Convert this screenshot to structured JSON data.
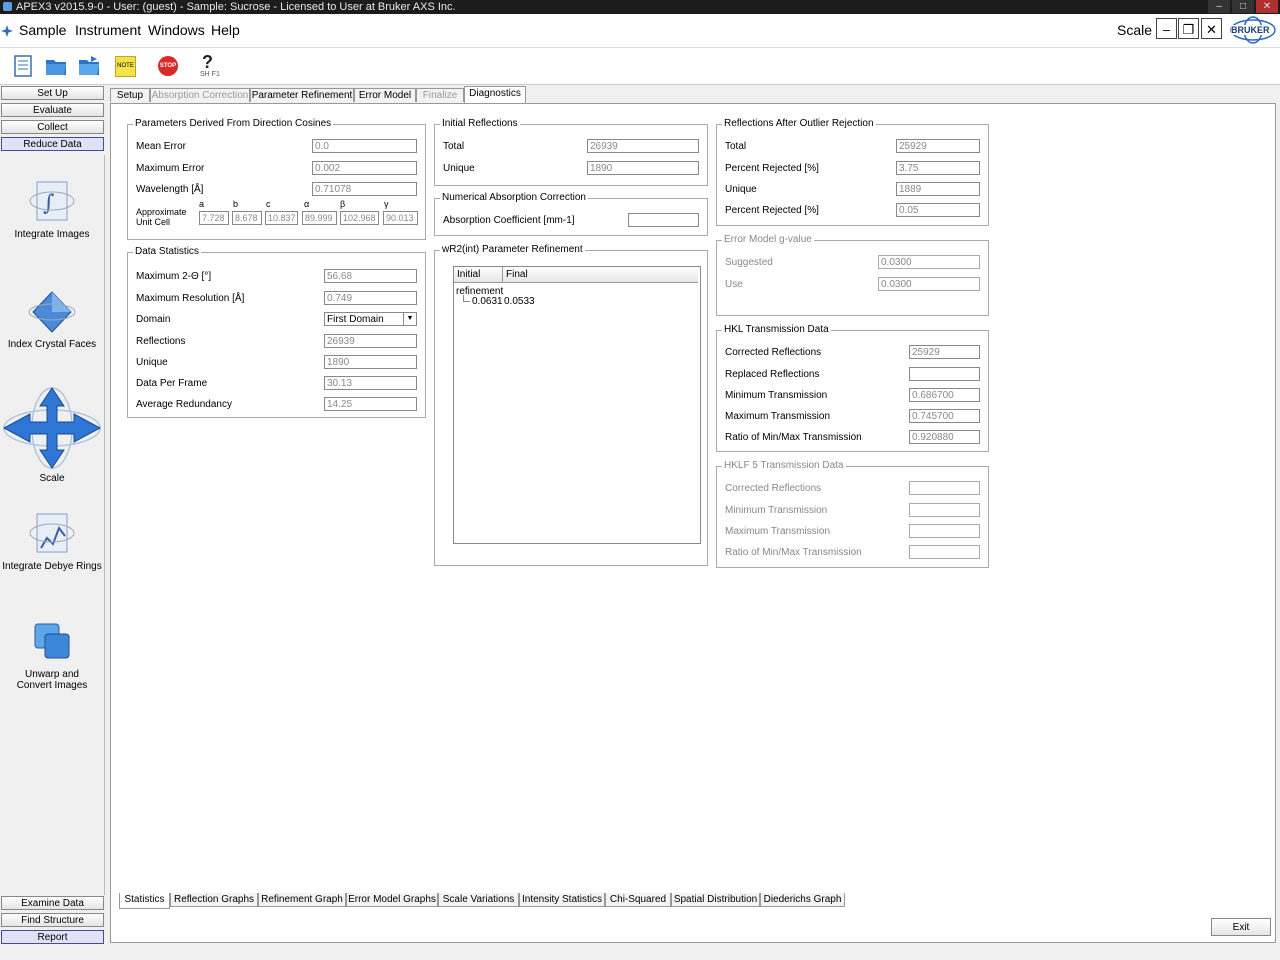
{
  "window": {
    "title": "APEX3 v2015.9-0 - User: (guest) - Sample: Sucrose - Licensed to User at Bruker AXS Inc."
  },
  "menu": {
    "items": [
      "Sample",
      "Instrument",
      "Windows",
      "Help"
    ],
    "current_view": "Scale",
    "brand": "BRUKER"
  },
  "toolbar": {
    "note_label": "NOTE",
    "stop_label": "STOP",
    "help_label": "SH F1"
  },
  "nav": {
    "top_buttons": [
      "Set Up",
      "Evaluate",
      "Collect",
      "Reduce Data"
    ],
    "tasks": [
      "Integrate Images",
      "Index Crystal Faces",
      "Scale",
      "Integrate Debye Rings",
      "Unwarp and Convert Images"
    ],
    "bottom_buttons": [
      "Examine Data",
      "Find Structure",
      "Report"
    ]
  },
  "top_tabs": [
    "Setup",
    "Absorption Correction",
    "Parameter Refinement",
    "Error Model",
    "Finalize",
    "Diagnostics"
  ],
  "direction_cosines": {
    "title": "Parameters Derived From Direction Cosines",
    "mean_error_label": "Mean Error",
    "mean_error": "0.0",
    "max_error_label": "Maximum Error",
    "max_error": "0.002",
    "wavelength_label": "Wavelength [Å]",
    "wavelength": "0.71078",
    "cell_label_1": "Approximate",
    "cell_label_2": "Unit Cell",
    "cell_headers": [
      "a",
      "b",
      "c",
      "α",
      "β",
      "γ"
    ],
    "cell_values": [
      "7.728",
      "8.678",
      "10.837",
      "89.999",
      "102.968",
      "90.013"
    ]
  },
  "data_statistics": {
    "title": "Data Statistics",
    "rows": [
      {
        "label": "Maximum 2-Θ [°]",
        "value": "56.68"
      },
      {
        "label": "Maximum Resolution [Å]",
        "value": "0.749"
      },
      {
        "label": "Domain",
        "value": "First Domain"
      },
      {
        "label": "Reflections",
        "value": "26939"
      },
      {
        "label": "Unique",
        "value": "1890"
      },
      {
        "label": "Data Per Frame",
        "value": "30.13"
      },
      {
        "label": "Average Redundancy",
        "value": "14.25"
      }
    ]
  },
  "initial_reflections": {
    "title": "Initial Reflections",
    "total_label": "Total",
    "total": "26939",
    "unique_label": "Unique",
    "unique": "1890"
  },
  "numerical_absorption": {
    "title": "Numerical Absorption Correction",
    "coef_label": "Absorption Coefficient [mm-1]",
    "coef": ""
  },
  "wr2_refinement": {
    "title": "wR2(int) Parameter Refinement",
    "col_initial": "Initial",
    "col_final": "Final",
    "node": "refinement",
    "initial": "0.0631",
    "final": "0.0533"
  },
  "after_outlier": {
    "title": "Reflections After Outlier Rejection",
    "rows": [
      {
        "label": "Total",
        "value": "25929"
      },
      {
        "label": "Percent Rejected [%]",
        "value": "3.75"
      },
      {
        "label": "Unique",
        "value": "1889"
      },
      {
        "label": "Percent Rejected [%]",
        "value": "0.05"
      }
    ]
  },
  "error_model": {
    "title": "Error Model g-value",
    "suggested_label": "Suggested",
    "suggested": "0.0300",
    "use_label": "Use",
    "use": "0.0300"
  },
  "hkl_transmission": {
    "title": "HKL Transmission Data",
    "rows": [
      {
        "label": "Corrected Reflections",
        "value": "25929"
      },
      {
        "label": "Replaced Reflections",
        "value": ""
      },
      {
        "label": "Minimum Transmission",
        "value": "0.686700"
      },
      {
        "label": "Maximum Transmission",
        "value": "0.745700"
      },
      {
        "label": "Ratio of Min/Max Transmission",
        "value": "0.920880"
      }
    ]
  },
  "hklf5_transmission": {
    "title": "HKLF 5 Transmission Data",
    "rows": [
      {
        "label": "Corrected Reflections",
        "value": ""
      },
      {
        "label": "Minimum Transmission",
        "value": ""
      },
      {
        "label": "Maximum Transmission",
        "value": ""
      },
      {
        "label": "Ratio of Min/Max Transmission",
        "value": ""
      }
    ]
  },
  "bottom_tabs": [
    "Statistics",
    "Reflection Graphs",
    "Refinement Graph",
    "Error Model Graphs",
    "Scale Variations",
    "Intensity Statistics",
    "Chi-Squared",
    "Spatial Distribution",
    "Diederichs Graph"
  ],
  "exit_label": "Exit"
}
